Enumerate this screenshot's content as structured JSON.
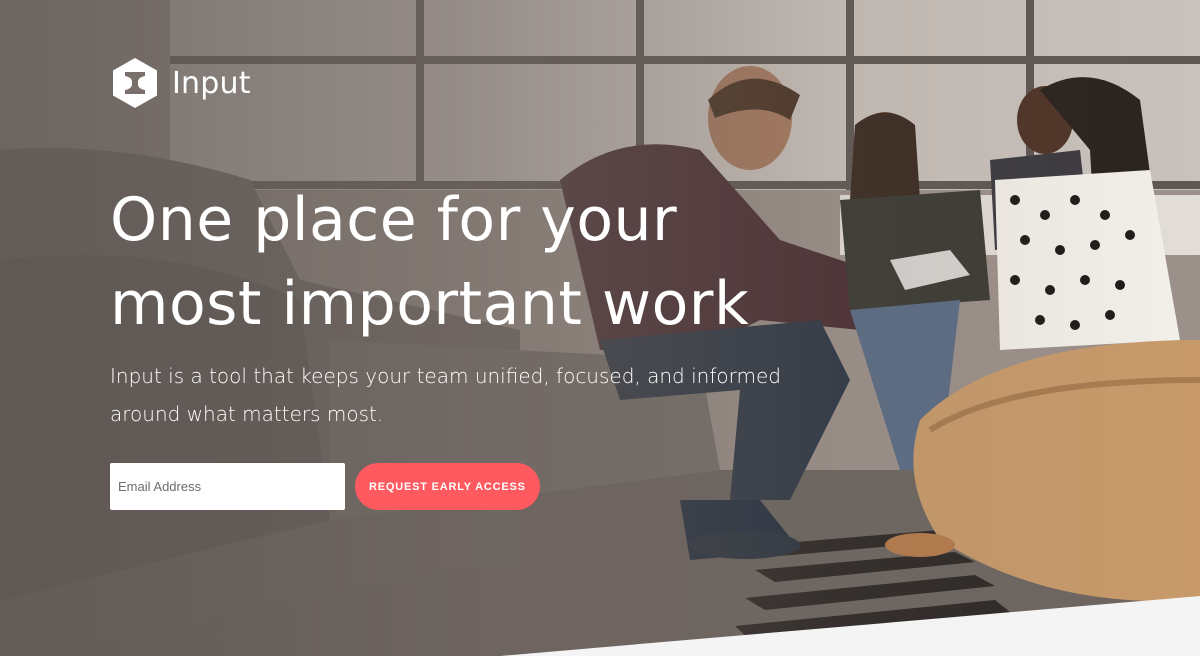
{
  "brand": {
    "name": "Input",
    "logo_icon": "hexagon-i-logo-icon"
  },
  "hero": {
    "headline_line1": "One place for your",
    "headline_line2": "most important work",
    "subhead": "Input is a tool that keeps your team unified, focused, and informed around what matters most."
  },
  "signup": {
    "email_placeholder": "Email Address",
    "cta_label": "REQUEST EARLY ACCESS"
  },
  "colors": {
    "accent": "#ff5a5f",
    "text": "#ffffff",
    "input_bg": "#ffffff"
  }
}
